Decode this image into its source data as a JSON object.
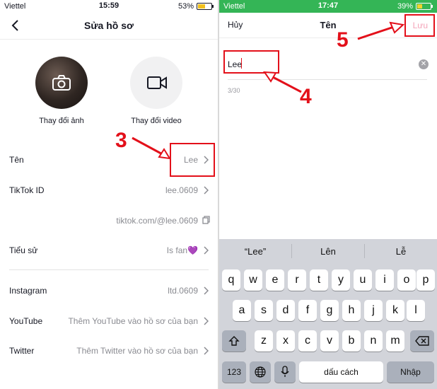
{
  "left": {
    "status": {
      "carrier": "Viettel",
      "time": "15:59",
      "battery": "53%",
      "battery_level": 0.53
    },
    "header": {
      "title": "Sửa hồ sơ"
    },
    "photo_label": "Thay đổi ảnh",
    "video_label": "Thay đổi video",
    "rows": [
      {
        "label": "Tên",
        "value": "Lee"
      },
      {
        "label": "TikTok ID",
        "value": "lee.0609"
      },
      {
        "label": "",
        "value": "tiktok.com/@lee.0609"
      },
      {
        "label": "Tiểu sử",
        "value": "Is fan💜"
      },
      {
        "label": "Instagram",
        "value": "ltd.0609"
      },
      {
        "label": "YouTube",
        "value": "Thêm YouTube vào hồ sơ của bạn"
      },
      {
        "label": "Twitter",
        "value": "Thêm Twitter vào hồ sơ của bạn"
      }
    ],
    "step": "3"
  },
  "right": {
    "status": {
      "carrier": "Viettel",
      "time": "17:47",
      "battery": "39%",
      "battery_level": 0.39
    },
    "header": {
      "cancel": "Hủy",
      "title": "Tên",
      "save": "Lưu"
    },
    "name_value": "Lee",
    "counter": "3/30",
    "steps": {
      "input": "4",
      "save": "5"
    },
    "keyboard": {
      "suggestions": [
        "“Lee”",
        "Lên",
        "Lễ"
      ],
      "row1": [
        "q",
        "w",
        "e",
        "r",
        "t",
        "y",
        "u",
        "i",
        "o",
        "p"
      ],
      "row2": [
        "a",
        "s",
        "d",
        "f",
        "g",
        "h",
        "j",
        "k",
        "l"
      ],
      "row3": [
        "z",
        "x",
        "c",
        "v",
        "b",
        "n",
        "m"
      ],
      "num_key": "123",
      "space_key": "dấu cách",
      "return_key": "Nhập"
    }
  },
  "colors": {
    "callout": "#e3101a",
    "status_green": "#34b556",
    "save_disabled": "#f4a5b9"
  },
  "icons": [
    "back-chevron-icon",
    "camera-icon",
    "video-camera-icon",
    "chevron-right-icon",
    "copy-icon",
    "clear-icon",
    "shift-icon",
    "backspace-icon",
    "globe-icon",
    "microphone-icon",
    "wifi-icon",
    "battery-icon"
  ]
}
